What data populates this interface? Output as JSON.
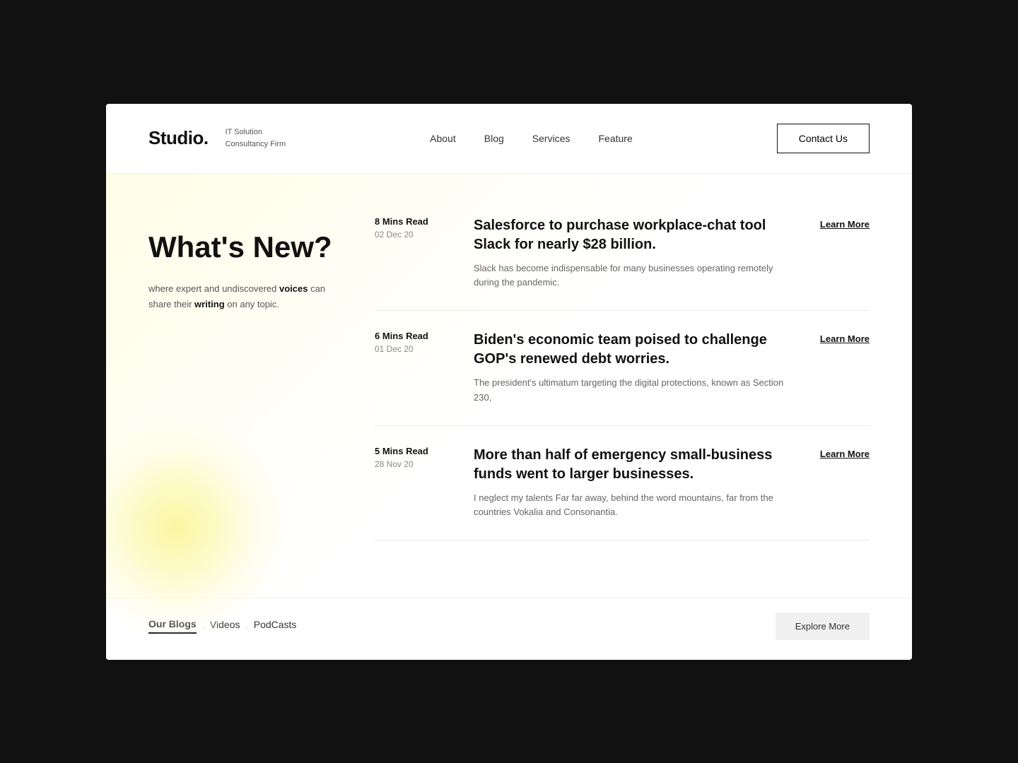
{
  "header": {
    "logo": "Studio.",
    "tagline_line1": "IT Solution",
    "tagline_line2": "Consultancy Firm",
    "nav": [
      {
        "label": "About",
        "href": "#"
      },
      {
        "label": "Blog",
        "href": "#"
      },
      {
        "label": "Services",
        "href": "#"
      },
      {
        "label": "Feature",
        "href": "#"
      }
    ],
    "contact_btn": "Contact Us"
  },
  "main": {
    "section_title": "What's New?",
    "section_desc_plain": "where expert and undiscovered ",
    "section_desc_bold1": "voices",
    "section_desc_mid": " can share their ",
    "section_desc_bold2": "writing",
    "section_desc_end": " on any topic."
  },
  "articles": [
    {
      "read_time": "8 Mins Read",
      "date": "02 Dec 20",
      "title": "Salesforce to purchase workplace-chat tool Slack for nearly $28 billion.",
      "excerpt": "Slack has become indispensable for many businesses operating remotely during the pandemic.",
      "learn_more": "Learn More"
    },
    {
      "read_time": "6 Mins Read",
      "date": "01 Dec 20",
      "title": "Biden's economic team poised to challenge GOP's renewed debt worries.",
      "excerpt": "The president's ultimatum targeting the digital protections, known as Section 230,",
      "learn_more": "Learn More"
    },
    {
      "read_time": "5 Mins Read",
      "date": "28 Nov 20",
      "title": "More than half of emergency small-business funds went to larger businesses.",
      "excerpt": "I neglect my talents Far far away, behind the word mountains, far from the countries Vokalia and Consonantia.",
      "learn_more": "Learn More"
    }
  ],
  "bottom": {
    "tabs": [
      {
        "label": "Our Blogs",
        "active": true
      },
      {
        "label": "Videos",
        "active": false
      },
      {
        "label": "PodCasts",
        "active": false
      }
    ],
    "explore_btn": "Explore More"
  }
}
